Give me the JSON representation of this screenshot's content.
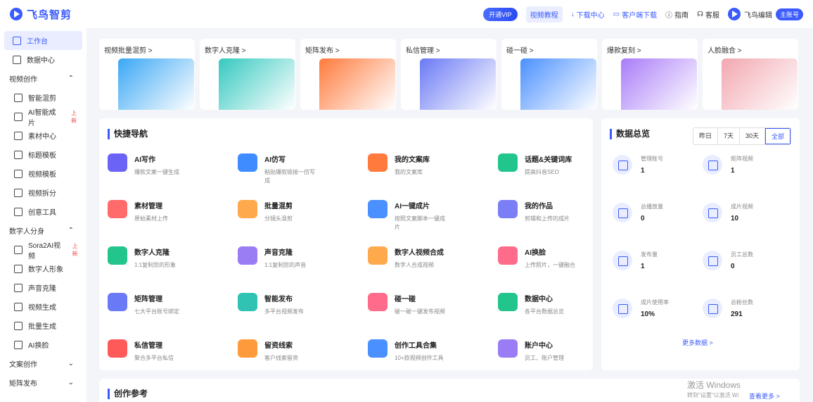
{
  "app": {
    "logo": "飞鸟智剪"
  },
  "topbar": {
    "vip": "开通VIP",
    "tutorial": "视频教程",
    "download": "下载中心",
    "client": "客户端下载",
    "guide": "指南",
    "service": "客服",
    "user": "飞鸟编辑",
    "role": "主账号"
  },
  "sidebar": {
    "items": [
      {
        "label": "工作台",
        "icon": "dashboard-icon"
      },
      {
        "label": "数据中心",
        "icon": "chart-icon"
      }
    ],
    "video_group": "视频创作",
    "video_items": [
      {
        "label": "智能混剪",
        "icon": "mix-icon",
        "tag": ""
      },
      {
        "label": "AI智能成片",
        "icon": "ai-video-icon",
        "tag": "上新"
      },
      {
        "label": "素材中心",
        "icon": "folder-icon",
        "tag": ""
      },
      {
        "label": "标题模板",
        "icon": "title-icon",
        "tag": ""
      },
      {
        "label": "视频模板",
        "icon": "template-icon",
        "tag": ""
      },
      {
        "label": "视频拆分",
        "icon": "split-icon",
        "tag": ""
      },
      {
        "label": "创意工具",
        "icon": "tool-icon",
        "tag": ""
      }
    ],
    "digital_group": "数字人分身",
    "digital_items": [
      {
        "label": "Sora2AI视频",
        "icon": "sora-icon",
        "tag": "上新"
      },
      {
        "label": "数字人形象",
        "icon": "avatar-icon",
        "tag": ""
      },
      {
        "label": "声音克隆",
        "icon": "mic-icon",
        "tag": ""
      },
      {
        "label": "视频生成",
        "icon": "video-icon",
        "tag": ""
      },
      {
        "label": "批量生成",
        "icon": "batch-icon",
        "tag": ""
      },
      {
        "label": "AI换脸",
        "icon": "face-icon",
        "tag": ""
      }
    ],
    "copy_group": "文案创作",
    "matrix_group": "矩阵发布"
  },
  "cards": [
    {
      "title": "视频批量混剪",
      "color": "#3aa7f5"
    },
    {
      "title": "数字人克隆",
      "color": "#35c9c0"
    },
    {
      "title": "矩阵发布",
      "color": "#ff7a3c"
    },
    {
      "title": "私信管理",
      "color": "#6a79f5"
    },
    {
      "title": "碰一碰",
      "color": "#4a90ff"
    },
    {
      "title": "爆款复刻",
      "color": "#a97cf8"
    },
    {
      "title": "人脸融合",
      "color": "#f2a7b0"
    }
  ],
  "quick": {
    "title": "快捷导航",
    "items": [
      {
        "name": "AI写作",
        "desc": "爆款文案一键生成",
        "color": "#6b63f5"
      },
      {
        "name": "AI仿写",
        "desc": "粘贴爆款链接一仿写成",
        "color": "#3e8cff"
      },
      {
        "name": "我的文案库",
        "desc": "我的文案库",
        "color": "#ff7a3c"
      },
      {
        "name": "话题&关键词库",
        "desc": "提高抖音SEO",
        "color": "#22c58b"
      },
      {
        "name": "素材管理",
        "desc": "原始素材上传",
        "color": "#ff6b6b"
      },
      {
        "name": "批量混剪",
        "desc": "分镜头混剪",
        "color": "#ffa94d"
      },
      {
        "name": "AI一键成片",
        "desc": "按照文案脚本一键成片",
        "color": "#4a90ff"
      },
      {
        "name": "我的作品",
        "desc": "剪辑和上传的成片",
        "color": "#7b7ff5"
      },
      {
        "name": "数字人克隆",
        "desc": "1:1复制您的形象",
        "color": "#22c58b"
      },
      {
        "name": "声音克隆",
        "desc": "1:1复制您的声音",
        "color": "#9a7cf5"
      },
      {
        "name": "数字人视频合成",
        "desc": "数字人合成视频",
        "color": "#ffa94d"
      },
      {
        "name": "AI换脸",
        "desc": "上传照片，一键融合",
        "color": "#ff6b8a"
      },
      {
        "name": "矩阵管理",
        "desc": "七大平台账号绑定",
        "color": "#6a79f5"
      },
      {
        "name": "智能发布",
        "desc": "多平台视频发布",
        "color": "#30c3b4"
      },
      {
        "name": "碰一碰",
        "desc": "碰一碰一键发布视频",
        "color": "#ff6b8a"
      },
      {
        "name": "数据中心",
        "desc": "各平台数据总览",
        "color": "#22c58b"
      },
      {
        "name": "私信管理",
        "desc": "聚合多平台私信",
        "color": "#ff5a5a"
      },
      {
        "name": "留资线索",
        "desc": "客户线索留资",
        "color": "#ff9a3c"
      },
      {
        "name": "创作工具合集",
        "desc": "10+款视频创作工具",
        "color": "#4a90ff"
      },
      {
        "name": "账户中心",
        "desc": "员工、账户管理",
        "color": "#9a7cf5"
      }
    ]
  },
  "stats": {
    "title": "数据总览",
    "ranges": [
      "昨日",
      "7天",
      "30天",
      "全部"
    ],
    "items": [
      {
        "label": "管理账号",
        "value": "1",
        "icon": "account-icon"
      },
      {
        "label": "矩阵视频",
        "value": "1",
        "icon": "matrix-video-icon"
      },
      {
        "label": "总播放量",
        "value": "0",
        "icon": "play-count-icon"
      },
      {
        "label": "成片视频",
        "value": "10",
        "icon": "finished-video-icon"
      },
      {
        "label": "发布量",
        "value": "1",
        "icon": "publish-icon"
      },
      {
        "label": "员工总数",
        "value": "0",
        "icon": "staff-icon"
      },
      {
        "label": "成片使用率",
        "value": "10%",
        "icon": "usage-rate-icon"
      },
      {
        "label": "总粉丝数",
        "value": "291",
        "icon": "fans-icon"
      }
    ],
    "more": "更多数据 >"
  },
  "reference": {
    "title": "创作参考",
    "more": "查看更多 >"
  },
  "watermark": {
    "line1": "激活 Windows",
    "line2": "转到\"设置\"以激活 Wi"
  }
}
